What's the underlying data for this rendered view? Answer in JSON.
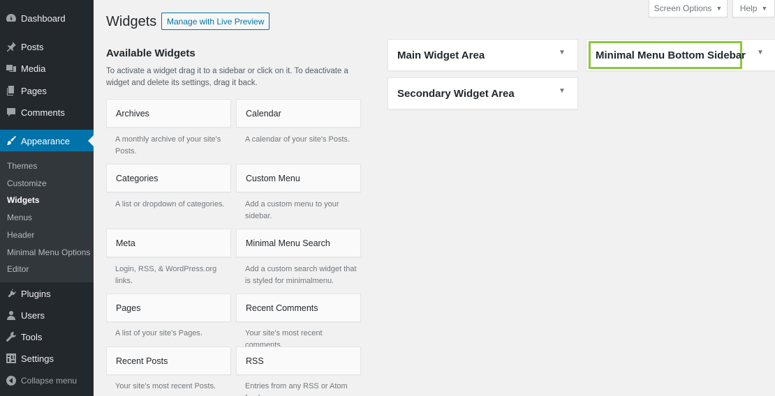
{
  "menu": {
    "dashboard": "Dashboard",
    "posts": "Posts",
    "media": "Media",
    "pages": "Pages",
    "comments": "Comments",
    "appearance": "Appearance",
    "plugins": "Plugins",
    "users": "Users",
    "tools": "Tools",
    "settings": "Settings",
    "collapse": "Collapse menu"
  },
  "submenu": {
    "themes": "Themes",
    "customize": "Customize",
    "widgets": "Widgets",
    "menus": "Menus",
    "header": "Header",
    "minimal_menu_options": "Minimal Menu Options",
    "editor": "Editor"
  },
  "screen_meta": {
    "screen_options": "Screen Options",
    "help": "Help"
  },
  "header": {
    "title": "Widgets",
    "live_preview": "Manage with Live Preview"
  },
  "available": {
    "title": "Available Widgets",
    "description": "To activate a widget drag it to a sidebar or click on it. To deactivate a widget and delete its settings, drag it back."
  },
  "widgets": [
    {
      "title": "Archives",
      "desc": "A monthly archive of your site's Posts."
    },
    {
      "title": "Calendar",
      "desc": "A calendar of your site's Posts."
    },
    {
      "title": "Categories",
      "desc": "A list or dropdown of categories."
    },
    {
      "title": "Custom Menu",
      "desc": "Add a custom menu to your sidebar."
    },
    {
      "title": "Meta",
      "desc": "Login, RSS, & WordPress.org links."
    },
    {
      "title": "Minimal Menu Search",
      "desc": "Add a custom search widget that is styled for minimalmenu."
    },
    {
      "title": "Pages",
      "desc": "A list of your site's Pages."
    },
    {
      "title": "Recent Comments",
      "desc": "Your site's most recent comments."
    },
    {
      "title": "Recent Posts",
      "desc": "Your site's most recent Posts."
    },
    {
      "title": "RSS",
      "desc": "Entries from any RSS or Atom feed."
    }
  ],
  "sidebars": {
    "main": "Main Widget Area",
    "secondary": "Secondary Widget Area",
    "minimal_bottom": "Minimal Menu Bottom Sidebar"
  },
  "colors": {
    "admin_bg": "#23282d",
    "submenu_bg": "#32373c",
    "accent": "#0073aa",
    "highlight": "#8dc63f"
  }
}
